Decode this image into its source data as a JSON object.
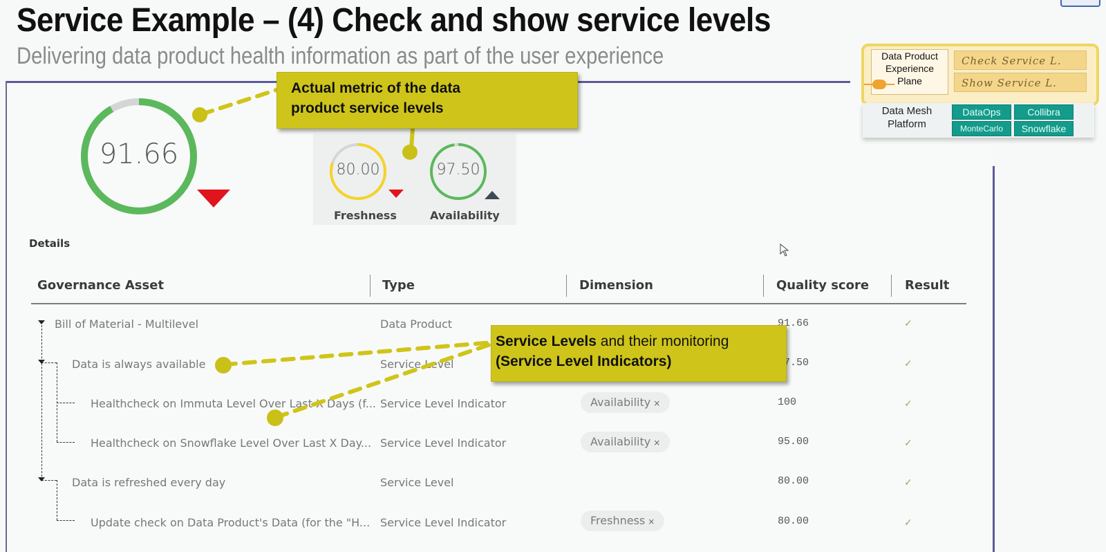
{
  "slide": {
    "title": "Service Example – (4) Check and show service levels",
    "subtitle": "Delivering data product health information as part of the user experience"
  },
  "callouts": {
    "metric_line1": "Actual metric of the data",
    "metric_line2": "product service levels",
    "service_levels_bold": "Service Levels",
    "service_levels_rest": " and their monitoring",
    "service_levels_line2": "(Service Level Indicators)"
  },
  "architecture": {
    "experience_plane_label_1": "Data Product",
    "experience_plane_label_2": "Experience",
    "experience_plane_label_3": "Plane",
    "check_label": "Check Service L.",
    "show_label": "Show Service L.",
    "mesh_label_1": "Data Mesh",
    "mesh_label_2": "Platform",
    "tools": [
      "DataOps",
      "Collibra",
      "MonteCarlo",
      "Snowflake"
    ],
    "colors": {
      "highlight": "#f0d560",
      "tool": "#139b8b"
    }
  },
  "gauges": {
    "overall": {
      "value": "91.66",
      "fraction": 0.9166,
      "trend": "down",
      "color": "#5cb85c"
    },
    "freshness": {
      "label": "Freshness",
      "value": "80.00",
      "fraction": 0.8,
      "trend": "down",
      "color": "#f5d327"
    },
    "availability": {
      "label": "Availability",
      "value": "97.50",
      "fraction": 0.975,
      "trend": "up",
      "color": "#5cb85c"
    }
  },
  "details": {
    "label": "Details",
    "columns": [
      "Governance Asset",
      "Type",
      "Dimension",
      "Quality score",
      "Result"
    ],
    "rows": [
      {
        "asset": "Bill of Material - Multilevel",
        "type": "Data Product",
        "dimension": "",
        "score": "91.66",
        "result": "✓",
        "level": 0
      },
      {
        "asset": "Data is always available",
        "type": "Service Level",
        "dimension": "",
        "score": "97.50",
        "result": "✓",
        "level": 1
      },
      {
        "asset": "Healthcheck on Immuta Level Over Last X Days (f...",
        "type": "Service Level Indicator",
        "dimension": "Availability",
        "score": "100",
        "result": "✓",
        "level": 2
      },
      {
        "asset": "Healthcheck on Snowflake Level Over Last X Day...",
        "type": "Service Level Indicator",
        "dimension": "Availability",
        "score": "95.00",
        "result": "✓",
        "level": 2
      },
      {
        "asset": "Data is refreshed every day",
        "type": "Service Level",
        "dimension": "",
        "score": "80.00",
        "result": "✓",
        "level": 1
      },
      {
        "asset": "Update check on Data Product's Data (for the \"H...",
        "type": "Service Level Indicator",
        "dimension": "Freshness",
        "score": "80.00",
        "result": "✓",
        "level": 2
      }
    ],
    "chip_remove_glyph": "×"
  }
}
